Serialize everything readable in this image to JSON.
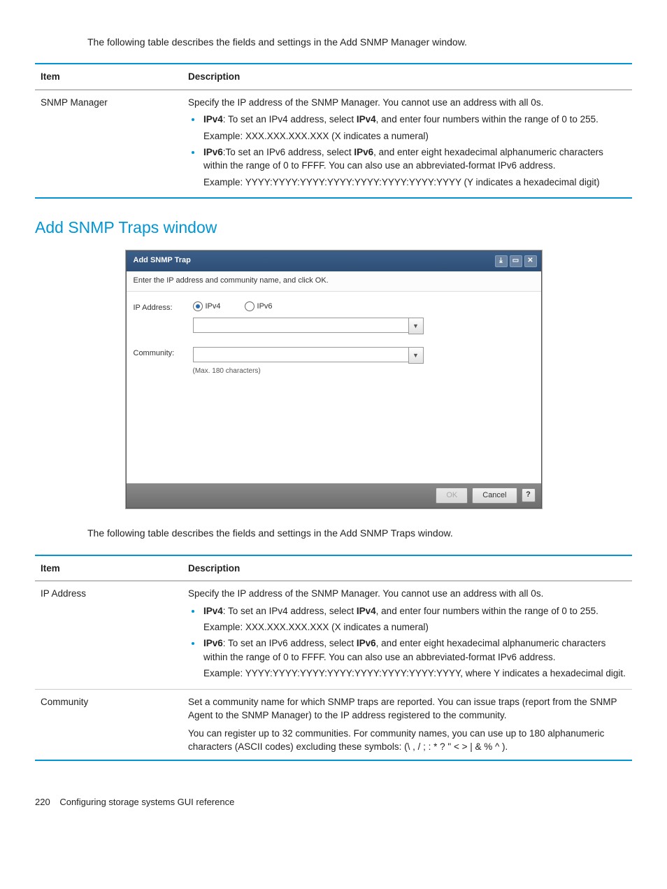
{
  "intro1": "The following table describes the fields and settings in the Add SNMP Manager window.",
  "table1": {
    "header_item": "Item",
    "header_desc": "Description",
    "row1_item": "SNMP Manager",
    "row1_intro": "Specify the IP address of the SNMP Manager. You cannot use an address with all 0s.",
    "row1_ipv4_a": "IPv4",
    "row1_ipv4_b": ": To set an IPv4 address, select ",
    "row1_ipv4_c": "IPv4",
    "row1_ipv4_d": ", and enter four numbers within the range of 0 to 255.",
    "row1_ipv4_ex": "Example: XXX.XXX.XXX.XXX (X indicates a numeral)",
    "row1_ipv6_a": "IPv6",
    "row1_ipv6_b": ":To set an IPv6 address, select ",
    "row1_ipv6_c": "IPv6",
    "row1_ipv6_d": ", and enter eight hexadecimal alphanumeric characters within the range of 0 to FFFF. You can also use an abbreviated-format IPv6 address.",
    "row1_ipv6_ex": "Example: YYYY:YYYY:YYYY:YYYY:YYYY:YYYY:YYYY:YYYY (Y indicates a hexadecimal digit)"
  },
  "section_heading": "Add SNMP Traps window",
  "dialog": {
    "title": "Add SNMP Trap",
    "subtitle": "Enter the IP address and community name, and click OK.",
    "ip_label": "IP Address:",
    "ipv4": "IPv4",
    "ipv6": "IPv6",
    "community_label": "Community:",
    "hint": "(Max. 180 characters)",
    "ok": "OK",
    "cancel": "Cancel",
    "help": "?"
  },
  "intro2": "The following table describes the fields and settings in the Add SNMP Traps window.",
  "table2": {
    "header_item": "Item",
    "header_desc": "Description",
    "r1_item": "IP Address",
    "r1_intro": "Specify the IP address of the SNMP Manager. You cannot use an address with all 0s.",
    "r1_ipv4_a": "IPv4",
    "r1_ipv4_b": ": To set an IPv4 address, select ",
    "r1_ipv4_c": "IPv4",
    "r1_ipv4_d": ", and enter four numbers within the range of 0 to 255.",
    "r1_ipv4_ex": "Example: XXX.XXX.XXX.XXX (X indicates a numeral)",
    "r1_ipv6_a": "IPv6",
    "r1_ipv6_b": ": To set an IPv6 address, select ",
    "r1_ipv6_c": "IPv6",
    "r1_ipv6_d": ", and enter eight hexadecimal alphanumeric characters within the range of 0 to FFFF. You can also use an abbreviated-format IPv6 address.",
    "r1_ipv6_ex": "Example: YYYY:YYYY:YYYY:YYYY:YYYY:YYYY:YYYY:YYYY, where Y indicates a hexadecimal digit.",
    "r2_item": "Community",
    "r2_p1": "Set a community name for which SNMP traps are reported. You can issue traps (report from the SNMP Agent to the SNMP Manager) to the IP address registered to the community.",
    "r2_p2": "You can register up to 32 communities. For community names, you can use up to 180 alphanumeric characters (ASCII codes) excluding these symbols: (\\ , / ; : * ? \" < > | & % ^ )."
  },
  "footer": {
    "page": "220",
    "chapter": "Configuring storage systems GUI reference"
  }
}
